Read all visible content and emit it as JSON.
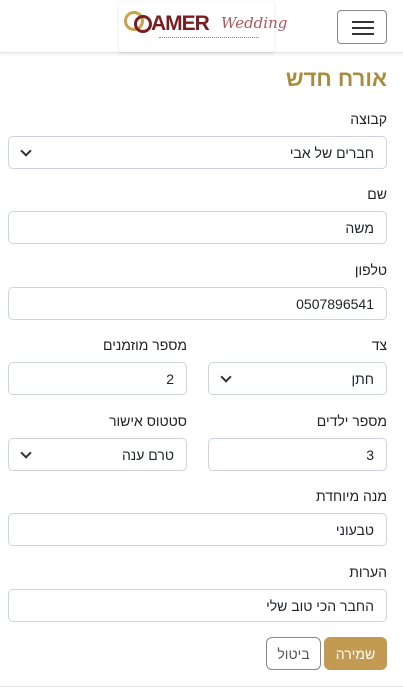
{
  "header": {
    "logo": {
      "brand": "AMER",
      "script": "Wedding"
    },
    "menu_icon": "hamburger-menu-icon"
  },
  "form": {
    "title": "אורח חדש",
    "group": {
      "label": "קבוצה",
      "value": "חברים של אבי"
    },
    "name": {
      "label": "שם",
      "value": "משה"
    },
    "phone": {
      "label": "טלפון",
      "value": "0507896541"
    },
    "side": {
      "label": "צד",
      "value": "חתן"
    },
    "invitees": {
      "label": "מספר מוזמנים",
      "value": "2"
    },
    "children": {
      "label": "מספר ילדים",
      "value": "3"
    },
    "approval": {
      "label": "סטטוס אישור",
      "value": "טרם ענה"
    },
    "special_meal": {
      "label": "מנה מיוחדת",
      "value": "טבעוני"
    },
    "notes": {
      "label": "הערות",
      "value": "החבר הכי טוב שלי"
    },
    "save_label": "שמירה",
    "cancel_label": "ביטול"
  },
  "colors": {
    "accent": "#a88c3f",
    "save_button": "#c39a52",
    "logo_maroon": "#7a1d22",
    "logo_gold": "#c9a24a"
  }
}
